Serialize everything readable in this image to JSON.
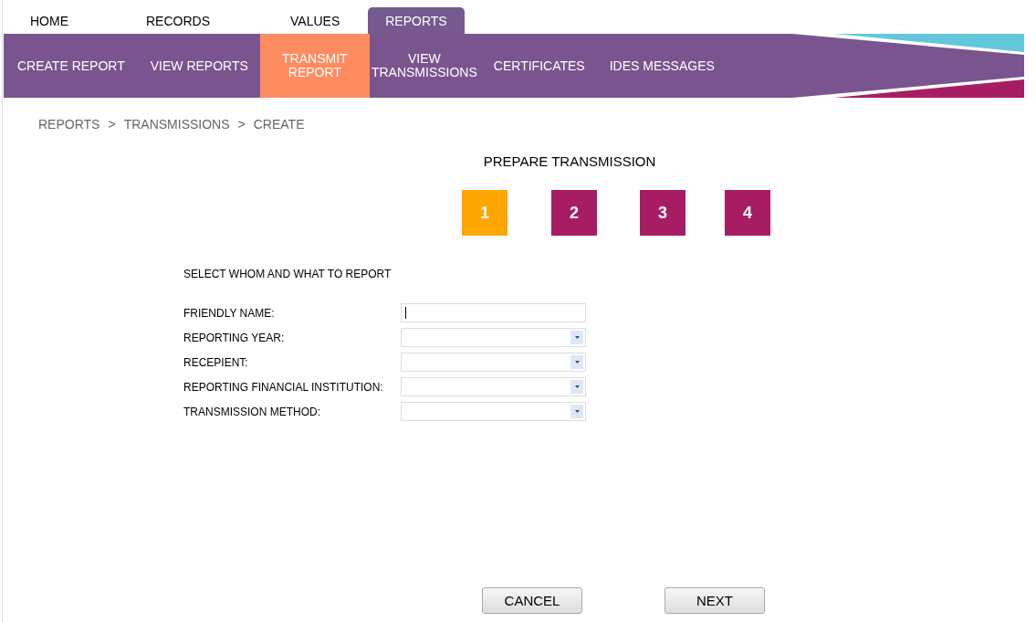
{
  "top_tabs": [
    {
      "label": "HOME",
      "selected": false
    },
    {
      "label": "RECORDS",
      "selected": false
    },
    {
      "label": "VALUES",
      "selected": false
    },
    {
      "label": "REPORTS",
      "selected": true
    }
  ],
  "sub_nav": [
    {
      "label": "CREATE REPORT",
      "selected": false
    },
    {
      "label": "VIEW REPORTS",
      "selected": false
    },
    {
      "label": "TRANSMIT REPORT",
      "selected": true
    },
    {
      "label": "VIEW TRANSMISSIONS",
      "selected": false
    },
    {
      "label": "CERTIFICATES",
      "selected": false
    },
    {
      "label": "IDES MESSAGES",
      "selected": false
    }
  ],
  "breadcrumb": [
    {
      "kind": "link",
      "text": "REPORTS"
    },
    {
      "kind": "separator",
      "text": ">"
    },
    {
      "kind": "link",
      "text": "TRANSMISSIONS"
    },
    {
      "kind": "separator",
      "text": ">"
    },
    {
      "kind": "link",
      "text": "CREATE"
    }
  ],
  "page_title": "PREPARE TRANSMISSION",
  "steps": [
    {
      "label": "1",
      "selected": true
    },
    {
      "label": "2",
      "selected": false
    },
    {
      "label": "3",
      "selected": false
    },
    {
      "label": "4",
      "selected": false
    }
  ],
  "section_title": "SELECT WHOM AND WHAT TO REPORT",
  "fields": [
    {
      "label": "FRIENDLY NAME:",
      "kind": "text",
      "focused": true
    },
    {
      "label": "REPORTING YEAR:",
      "kind": "select",
      "focused": false
    },
    {
      "label": "RECEPIENT:",
      "kind": "select",
      "focused": false
    },
    {
      "label": "REPORTING FINANCIAL INSTITUTION:",
      "kind": "select",
      "focused": false
    },
    {
      "label": "TRANSMISSION METHOD:",
      "kind": "select",
      "focused": false
    }
  ],
  "buttons": [
    "CANCEL",
    "NEXT"
  ]
}
